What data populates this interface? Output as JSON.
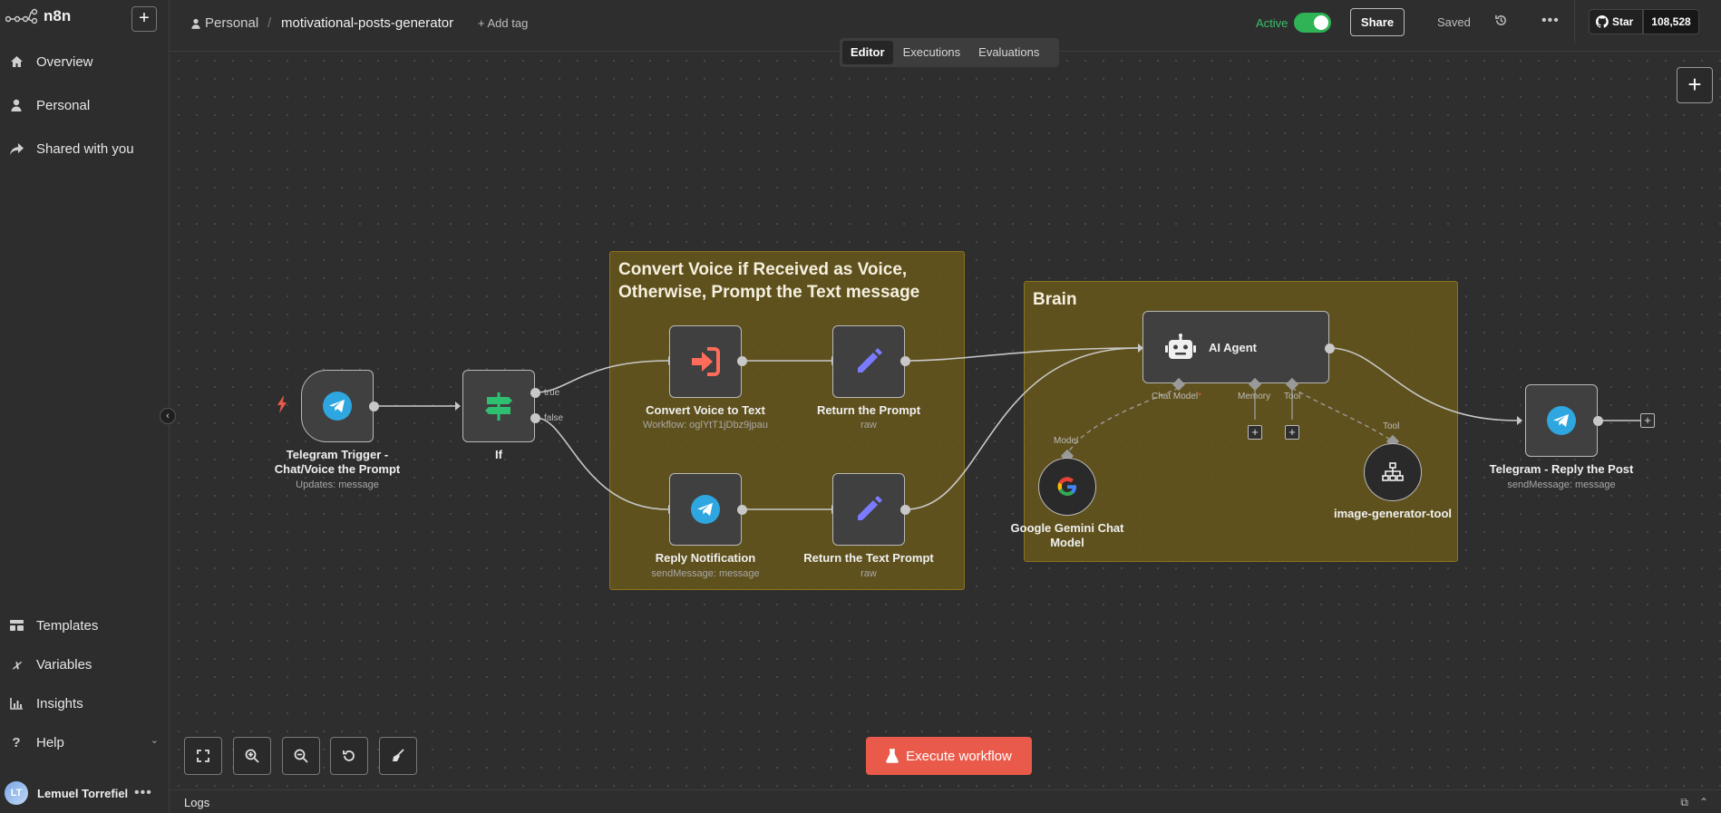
{
  "app": {
    "name": "n8n"
  },
  "sidebar": {
    "items": [
      {
        "label": "Overview",
        "icon": "home-icon"
      },
      {
        "label": "Personal",
        "icon": "user-icon"
      },
      {
        "label": "Shared with you",
        "icon": "share-icon"
      }
    ],
    "bottom_items": [
      {
        "label": "Templates",
        "icon": "templates-icon"
      },
      {
        "label": "Variables",
        "icon": "variables-icon"
      },
      {
        "label": "Insights",
        "icon": "insights-icon"
      },
      {
        "label": "Help",
        "icon": "help-icon"
      }
    ],
    "user": {
      "initials": "LT",
      "name": "Lemuel Torrefiel"
    }
  },
  "header": {
    "project": "Personal",
    "separator": "/",
    "workflow_name": "motivational-posts-generator",
    "add_tag": "+ Add tag",
    "active_label": "Active",
    "active": true,
    "share_label": "Share",
    "saved_label": "Saved",
    "github": {
      "star_label": "Star",
      "count": "108,528"
    }
  },
  "tabs": [
    {
      "label": "Editor",
      "active": true
    },
    {
      "label": "Executions",
      "active": false
    },
    {
      "label": "Evaluations",
      "active": false
    }
  ],
  "canvas": {
    "stickies": [
      {
        "title": "Convert Voice if Received as Voice, Otherwise, Prompt the Text message"
      },
      {
        "title": "Brain"
      }
    ],
    "nodes": {
      "telegram_trigger": {
        "label": "Telegram Trigger - Chat/Voice the Prompt",
        "sub": "Updates: message",
        "icon": "telegram-icon"
      },
      "if": {
        "label": "If",
        "icon": "signpost-icon",
        "out_true": "true",
        "out_false": "false"
      },
      "convert_voice": {
        "label": "Convert Voice to Text",
        "sub": "Workflow: oglYtT1jDbz9jpau",
        "icon": "execute-workflow-icon"
      },
      "return_prompt": {
        "label": "Return the Prompt",
        "sub": "raw",
        "icon": "pencil-icon"
      },
      "reply_notification": {
        "label": "Reply Notification",
        "sub": "sendMessage: message",
        "icon": "telegram-icon"
      },
      "return_text_prompt": {
        "label": "Return the Text Prompt",
        "sub": "raw",
        "icon": "pencil-icon"
      },
      "ai_agent": {
        "label": "AI Agent",
        "icon": "robot-icon",
        "port_chat_model": "Chat Model",
        "required_mark": "*",
        "port_memory": "Memory",
        "port_tool": "Tool"
      },
      "gemini": {
        "label": "Google Gemini Chat Model",
        "port": "Model",
        "icon": "google-icon"
      },
      "image_tool": {
        "label": "image-generator-tool",
        "port": "Tool",
        "icon": "sitemap-icon"
      },
      "telegram_reply": {
        "label": "Telegram - Reply the Post",
        "sub": "sendMessage: message",
        "icon": "telegram-icon"
      }
    }
  },
  "execute_button": {
    "label": "Execute workflow"
  },
  "logs": {
    "label": "Logs"
  },
  "colors": {
    "accent": "#ea5a4a",
    "active": "#2eb356",
    "sticky": "#6d5b18",
    "telegram": "#2ea6e0",
    "pencil": "#7b7bff",
    "if_green": "#2fbf71"
  }
}
